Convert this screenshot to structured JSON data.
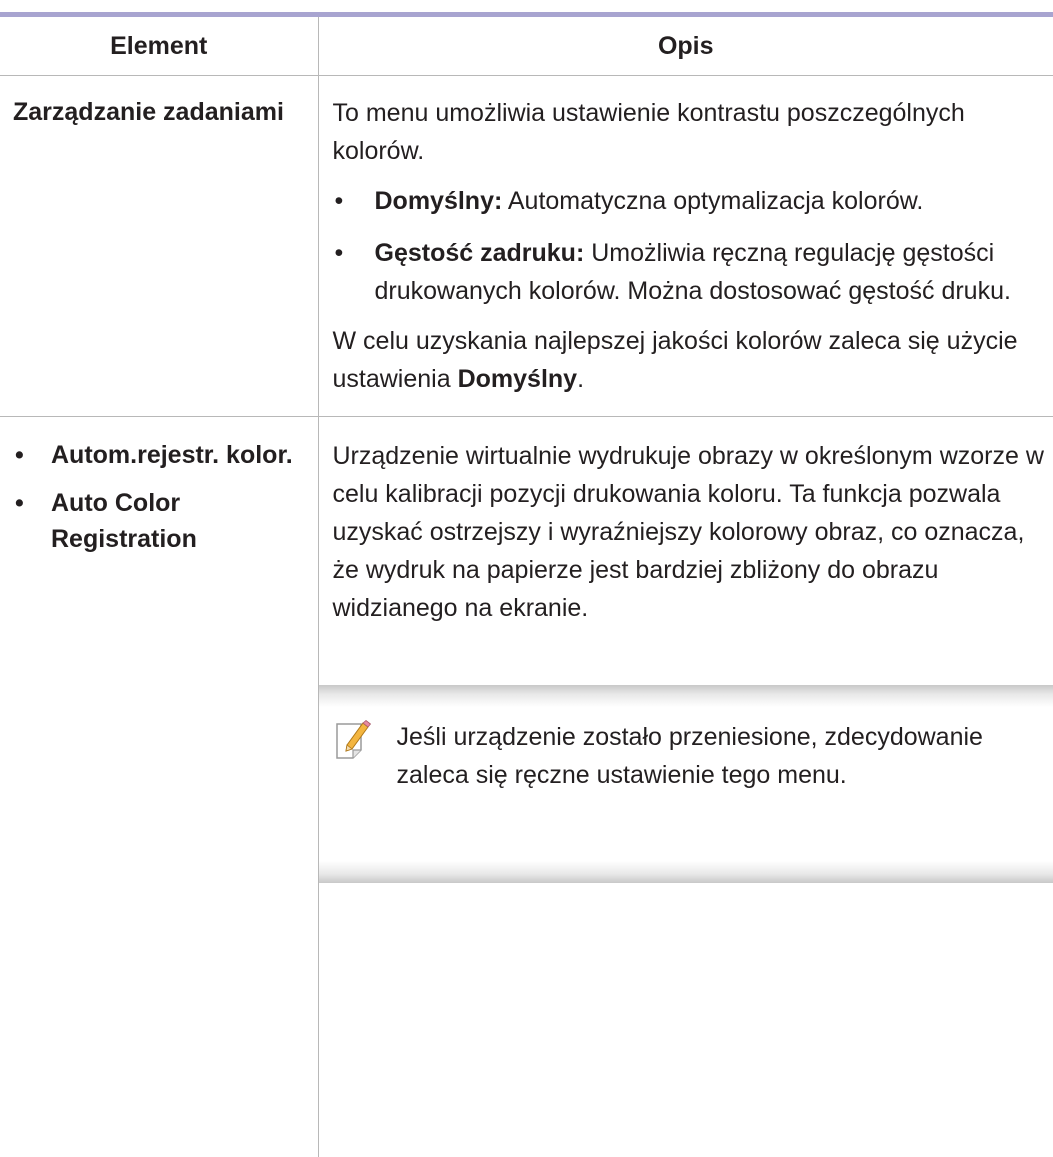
{
  "table": {
    "header": {
      "col1": "Element",
      "col2": "Opis"
    },
    "row1": {
      "element": "Zarządzanie zadaniami",
      "intro": "To menu umożliwia ustawienie kontrastu poszczególnych kolorów.",
      "bullets": [
        {
          "term": "Domyślny:",
          "text": " Automatyczna optymalizacja kolorów."
        },
        {
          "term": "Gęstość zadruku:",
          "text": " Umożliwia ręczną regulację gęstości drukowanych kolorów. Można dostosować gęstość druku."
        }
      ],
      "outro_before": "W celu uzyskania najlepszej jakości kolorów zaleca się użycie ustawienia ",
      "outro_bold": "Domyślny",
      "outro_after": "."
    },
    "row2": {
      "elements": [
        "Autom.rejestr. kolor.",
        "Auto Color Registration"
      ],
      "description": "Urządzenie wirtualnie wydrukuje obrazy w określonym wzorze w celu kalibracji pozycji drukowania koloru. Ta funkcja pozwala uzyskać ostrzejszy i wyraźniejszy kolorowy obraz, co oznacza, że wydruk na papierze jest bardziej zbliżony do obrazu widzianego na ekranie.",
      "note": {
        "icon": "note-pencil-icon",
        "text": "Jeśli urządzenie zostało przeniesione, zdecydowanie zaleca się ręczne ustawienie tego menu."
      }
    },
    "bullet_glyph": "•"
  },
  "colors": {
    "header_rule": "#a8a4d0",
    "grid_line": "#b8b8b8",
    "text": "#231f20"
  }
}
